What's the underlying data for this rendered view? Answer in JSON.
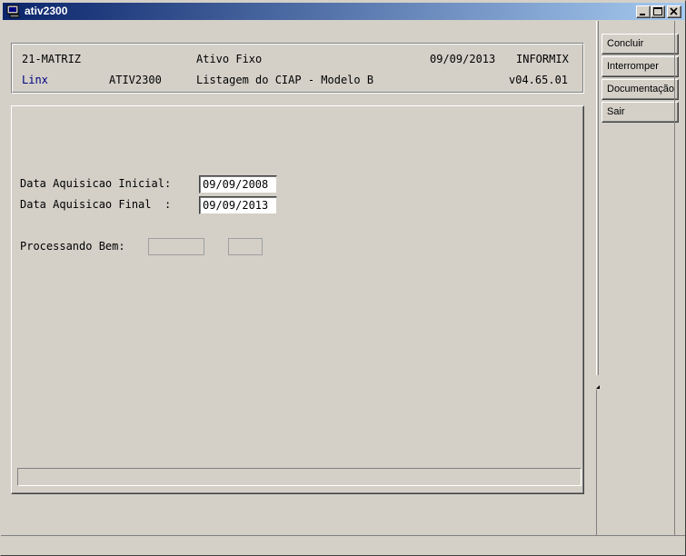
{
  "window": {
    "title": "ativ2300"
  },
  "header": {
    "company": "21-MATRIZ",
    "module": "Ativo Fixo",
    "date": "09/09/2013",
    "db": "INFORMIX",
    "vendor": "Linx",
    "program": "ATIV2300",
    "report_title": "Listagem do CIAP - Modelo B",
    "version": "v04.65.01"
  },
  "form": {
    "initial_label": "Data Aquisicao Inicial:",
    "initial_value": "09/09/2008",
    "final_label": "Data Aquisicao Final  :",
    "final_value": "09/09/2013",
    "processing_label": "Processando Bem:",
    "processing_value_1": "",
    "processing_value_2": ""
  },
  "status": {
    "text": ""
  },
  "buttons": {
    "concluir": "Concluir",
    "interromper": "Interromper",
    "documentacao": "Documentação",
    "sair": "Sair"
  },
  "colors": {
    "titlebar_start": "#0a246a",
    "titlebar_end": "#a6caf0",
    "face": "#d4d0c8",
    "vendor_text": "#000080"
  },
  "icons": {
    "title": "app-window-icon",
    "minimize": "minimize-icon",
    "maximize": "maximize-icon",
    "close": "close-icon"
  }
}
